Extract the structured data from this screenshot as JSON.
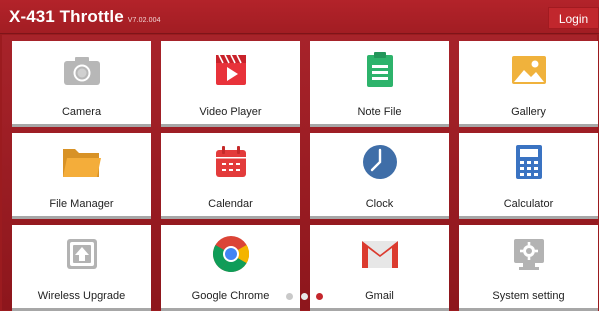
{
  "header": {
    "title": "X-431 Throttle",
    "version": "V7.02.004",
    "login_label": "Login"
  },
  "apps": [
    {
      "label": "Camera",
      "icon": "camera-icon",
      "color": "#b3b3b3"
    },
    {
      "label": "Video Player",
      "icon": "video-player-icon",
      "color": "#e8323a"
    },
    {
      "label": "Note File",
      "icon": "note-file-icon",
      "color": "#2db36b"
    },
    {
      "label": "Gallery",
      "icon": "gallery-icon",
      "color": "#f0b23c"
    },
    {
      "label": "File Manager",
      "icon": "folder-icon",
      "color": "#f0a93a"
    },
    {
      "label": "Calendar",
      "icon": "calendar-icon",
      "color": "#e33b3b"
    },
    {
      "label": "Clock",
      "icon": "clock-icon",
      "color": "#3f6ea8"
    },
    {
      "label": "Calculator",
      "icon": "calculator-icon",
      "color": "#3a73c2"
    },
    {
      "label": "Wireless Upgrade",
      "icon": "upgrade-icon",
      "color": "#b3b3b3"
    },
    {
      "label": "Google Chrome",
      "icon": "chrome-icon",
      "color": "#4285f4"
    },
    {
      "label": "Gmail",
      "icon": "gmail-icon",
      "color": "#db3b2f"
    },
    {
      "label": "System setting",
      "icon": "settings-icon",
      "color": "#b3b3b3"
    }
  ],
  "pager": {
    "page_count": 3,
    "active_page": 3
  }
}
